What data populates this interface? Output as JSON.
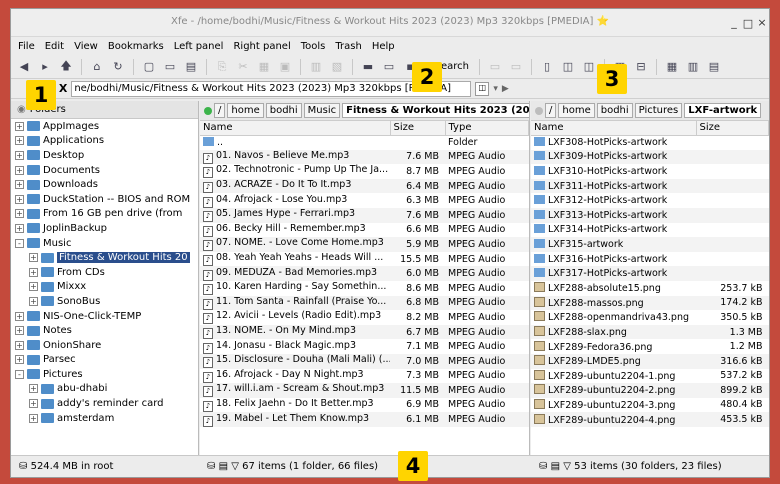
{
  "title_bar": {
    "title": "Xfe - /home/bodhi/Music/Fitness & Workout Hits 2023 (2023) Mp3 320kbps [PMEDIA]",
    "star": "⭐",
    "minimize": "_",
    "maximize": "□",
    "close": "×"
  },
  "menu": [
    "File",
    "Edit",
    "View",
    "Bookmarks",
    "Left panel",
    "Right panel",
    "Tools",
    "Trash",
    "Help"
  ],
  "toolbar": {
    "search_label": "Search"
  },
  "location": {
    "label": "on:",
    "clear": "X",
    "value": "ne/bodhi/Music/Fitness & Workout Hits 2023 (2023) Mp3 320kbps [PMEDIA]"
  },
  "tree": {
    "header": "Folders",
    "items": [
      {
        "label": "AppImages",
        "expander": "+",
        "level": 0
      },
      {
        "label": "Applications",
        "expander": "+",
        "level": 0
      },
      {
        "label": "Desktop",
        "expander": "+",
        "level": 0
      },
      {
        "label": "Documents",
        "expander": "+",
        "level": 0
      },
      {
        "label": "Downloads",
        "expander": "+",
        "level": 0
      },
      {
        "label": "DuckStation -- BIOS and ROM",
        "expander": "+",
        "level": 0
      },
      {
        "label": "From 16 GB pen drive (from",
        "expander": "+",
        "level": 0
      },
      {
        "label": "JoplinBackup",
        "expander": "+",
        "level": 0
      },
      {
        "label": "Music",
        "expander": "-",
        "level": 0
      },
      {
        "label": "Fitness & Workout Hits 20",
        "expander": "+",
        "level": 1,
        "selected": true
      },
      {
        "label": "From CDs",
        "expander": "+",
        "level": 1
      },
      {
        "label": "Mixxx",
        "expander": "+",
        "level": 1
      },
      {
        "label": "SonoBus",
        "expander": "+",
        "level": 1
      },
      {
        "label": "NIS-One-Click-TEMP",
        "expander": "+",
        "level": 0
      },
      {
        "label": "Notes",
        "expander": "+",
        "level": 0
      },
      {
        "label": "OnionShare",
        "expander": "+",
        "level": 0
      },
      {
        "label": "Parsec",
        "expander": "+",
        "level": 0
      },
      {
        "label": "Pictures",
        "expander": "-",
        "level": 0
      },
      {
        "label": "abu-dhabi",
        "expander": "+",
        "level": 1
      },
      {
        "label": "addy's reminder card",
        "expander": "+",
        "level": 1
      },
      {
        "label": "amsterdam",
        "expander": "+",
        "level": 1
      }
    ]
  },
  "left_panel": {
    "breadcrumbs": [
      "/",
      "home",
      "bodhi",
      "Music",
      "Fitness & Workout Hits 2023 (20"
    ],
    "columns": [
      "Name",
      "Size",
      "Type"
    ],
    "rows": [
      {
        "name": "..",
        "size": "",
        "type": "Folder",
        "kind": "dir"
      },
      {
        "name": "01. Navos - Believe Me.mp3",
        "size": "7.6 MB",
        "type": "MPEG Audio",
        "kind": "file"
      },
      {
        "name": "02. Technotronic - Pump Up The Ja...",
        "size": "8.7 MB",
        "type": "MPEG Audio",
        "kind": "file"
      },
      {
        "name": "03. ACRAZE - Do It To It.mp3",
        "size": "6.4 MB",
        "type": "MPEG Audio",
        "kind": "file"
      },
      {
        "name": "04. Afrojack - Lose You.mp3",
        "size": "6.3 MB",
        "type": "MPEG Audio",
        "kind": "file"
      },
      {
        "name": "05. James Hype - Ferrari.mp3",
        "size": "7.6 MB",
        "type": "MPEG Audio",
        "kind": "file"
      },
      {
        "name": "06. Becky Hill - Remember.mp3",
        "size": "6.6 MB",
        "type": "MPEG Audio",
        "kind": "file"
      },
      {
        "name": "07. NOME. - Love Come Home.mp3",
        "size": "5.9 MB",
        "type": "MPEG Audio",
        "kind": "file"
      },
      {
        "name": "08. Yeah Yeah Yeahs - Heads Will ...",
        "size": "15.5 MB",
        "type": "MPEG Audio",
        "kind": "file"
      },
      {
        "name": "09. MEDUZA - Bad Memories.mp3",
        "size": "6.0 MB",
        "type": "MPEG Audio",
        "kind": "file"
      },
      {
        "name": "10. Karen Harding - Say Somethin...",
        "size": "8.6 MB",
        "type": "MPEG Audio",
        "kind": "file"
      },
      {
        "name": "11. Tom Santa - Rainfall (Praise Yo...",
        "size": "6.8 MB",
        "type": "MPEG Audio",
        "kind": "file"
      },
      {
        "name": "12. Avicii - Levels (Radio Edit).mp3",
        "size": "8.2 MB",
        "type": "MPEG Audio",
        "kind": "file"
      },
      {
        "name": "13. NOME. - On My Mind.mp3",
        "size": "6.7 MB",
        "type": "MPEG Audio",
        "kind": "file"
      },
      {
        "name": "14. Jonasu - Black Magic.mp3",
        "size": "7.1 MB",
        "type": "MPEG Audio",
        "kind": "file"
      },
      {
        "name": "15. Disclosure - Douha (Mali Mali) (...",
        "size": "7.0 MB",
        "type": "MPEG Audio",
        "kind": "file"
      },
      {
        "name": "16. Afrojack - Day N Night.mp3",
        "size": "7.3 MB",
        "type": "MPEG Audio",
        "kind": "file"
      },
      {
        "name": "17. will.i.am - Scream & Shout.mp3",
        "size": "11.5 MB",
        "type": "MPEG Audio",
        "kind": "file"
      },
      {
        "name": "18. Felix Jaehn - Do It Better.mp3",
        "size": "6.9 MB",
        "type": "MPEG Audio",
        "kind": "file"
      },
      {
        "name": "19. Mabel - Let Them Know.mp3",
        "size": "6.1 MB",
        "type": "MPEG Audio",
        "kind": "file"
      }
    ],
    "status": "67 items (1 folder, 66 files)"
  },
  "right_panel": {
    "breadcrumbs": [
      "/",
      "home",
      "bodhi",
      "Pictures",
      "LXF-artwork"
    ],
    "columns": [
      "Name",
      "Size"
    ],
    "rows": [
      {
        "name": "LXF308-HotPicks-artwork",
        "size": "",
        "kind": "dir"
      },
      {
        "name": "LXF309-HotPicks-artwork",
        "size": "",
        "kind": "dir"
      },
      {
        "name": "LXF310-HotPicks-artwork",
        "size": "",
        "kind": "dir"
      },
      {
        "name": "LXF311-HotPicks-artwork",
        "size": "",
        "kind": "dir"
      },
      {
        "name": "LXF312-HotPicks-artwork",
        "size": "",
        "kind": "dir"
      },
      {
        "name": "LXF313-HotPicks-artwork",
        "size": "",
        "kind": "dir"
      },
      {
        "name": "LXF314-HotPicks-artwork",
        "size": "",
        "kind": "dir"
      },
      {
        "name": "LXF315-artwork",
        "size": "",
        "kind": "dir"
      },
      {
        "name": "LXF316-HotPicks-artwork",
        "size": "",
        "kind": "dir"
      },
      {
        "name": "LXF317-HotPicks-artwork",
        "size": "",
        "kind": "dir"
      },
      {
        "name": "LXF288-absolute15.png",
        "size": "253.7 kB",
        "kind": "img"
      },
      {
        "name": "LXF288-massos.png",
        "size": "174.2 kB",
        "kind": "img"
      },
      {
        "name": "LXF288-openmandriva43.png",
        "size": "350.5 kB",
        "kind": "img"
      },
      {
        "name": "LXF288-slax.png",
        "size": "1.3 MB",
        "kind": "img"
      },
      {
        "name": "LXF289-Fedora36.png",
        "size": "1.2 MB",
        "kind": "img"
      },
      {
        "name": "LXF289-LMDE5.png",
        "size": "316.6 kB",
        "kind": "img"
      },
      {
        "name": "LXF289-ubuntu2204-1.png",
        "size": "537.2 kB",
        "kind": "img"
      },
      {
        "name": "LXF289-ubuntu2204-2.png",
        "size": "899.2 kB",
        "kind": "img"
      },
      {
        "name": "LXF289-ubuntu2204-3.png",
        "size": "480.4 kB",
        "kind": "img"
      },
      {
        "name": "LXF289-ubuntu2204-4.png",
        "size": "453.5 kB",
        "kind": "img"
      }
    ],
    "status": "53 items (30 folders, 23 files)"
  },
  "tree_status": "524.4 MB in root",
  "badges": [
    "1",
    "2",
    "3",
    "4"
  ],
  "colors": {
    "selection": "#2a4e8c",
    "badge": "#ffd400",
    "folder": "#4f8dc9",
    "active_dot": "#3cb44b"
  }
}
